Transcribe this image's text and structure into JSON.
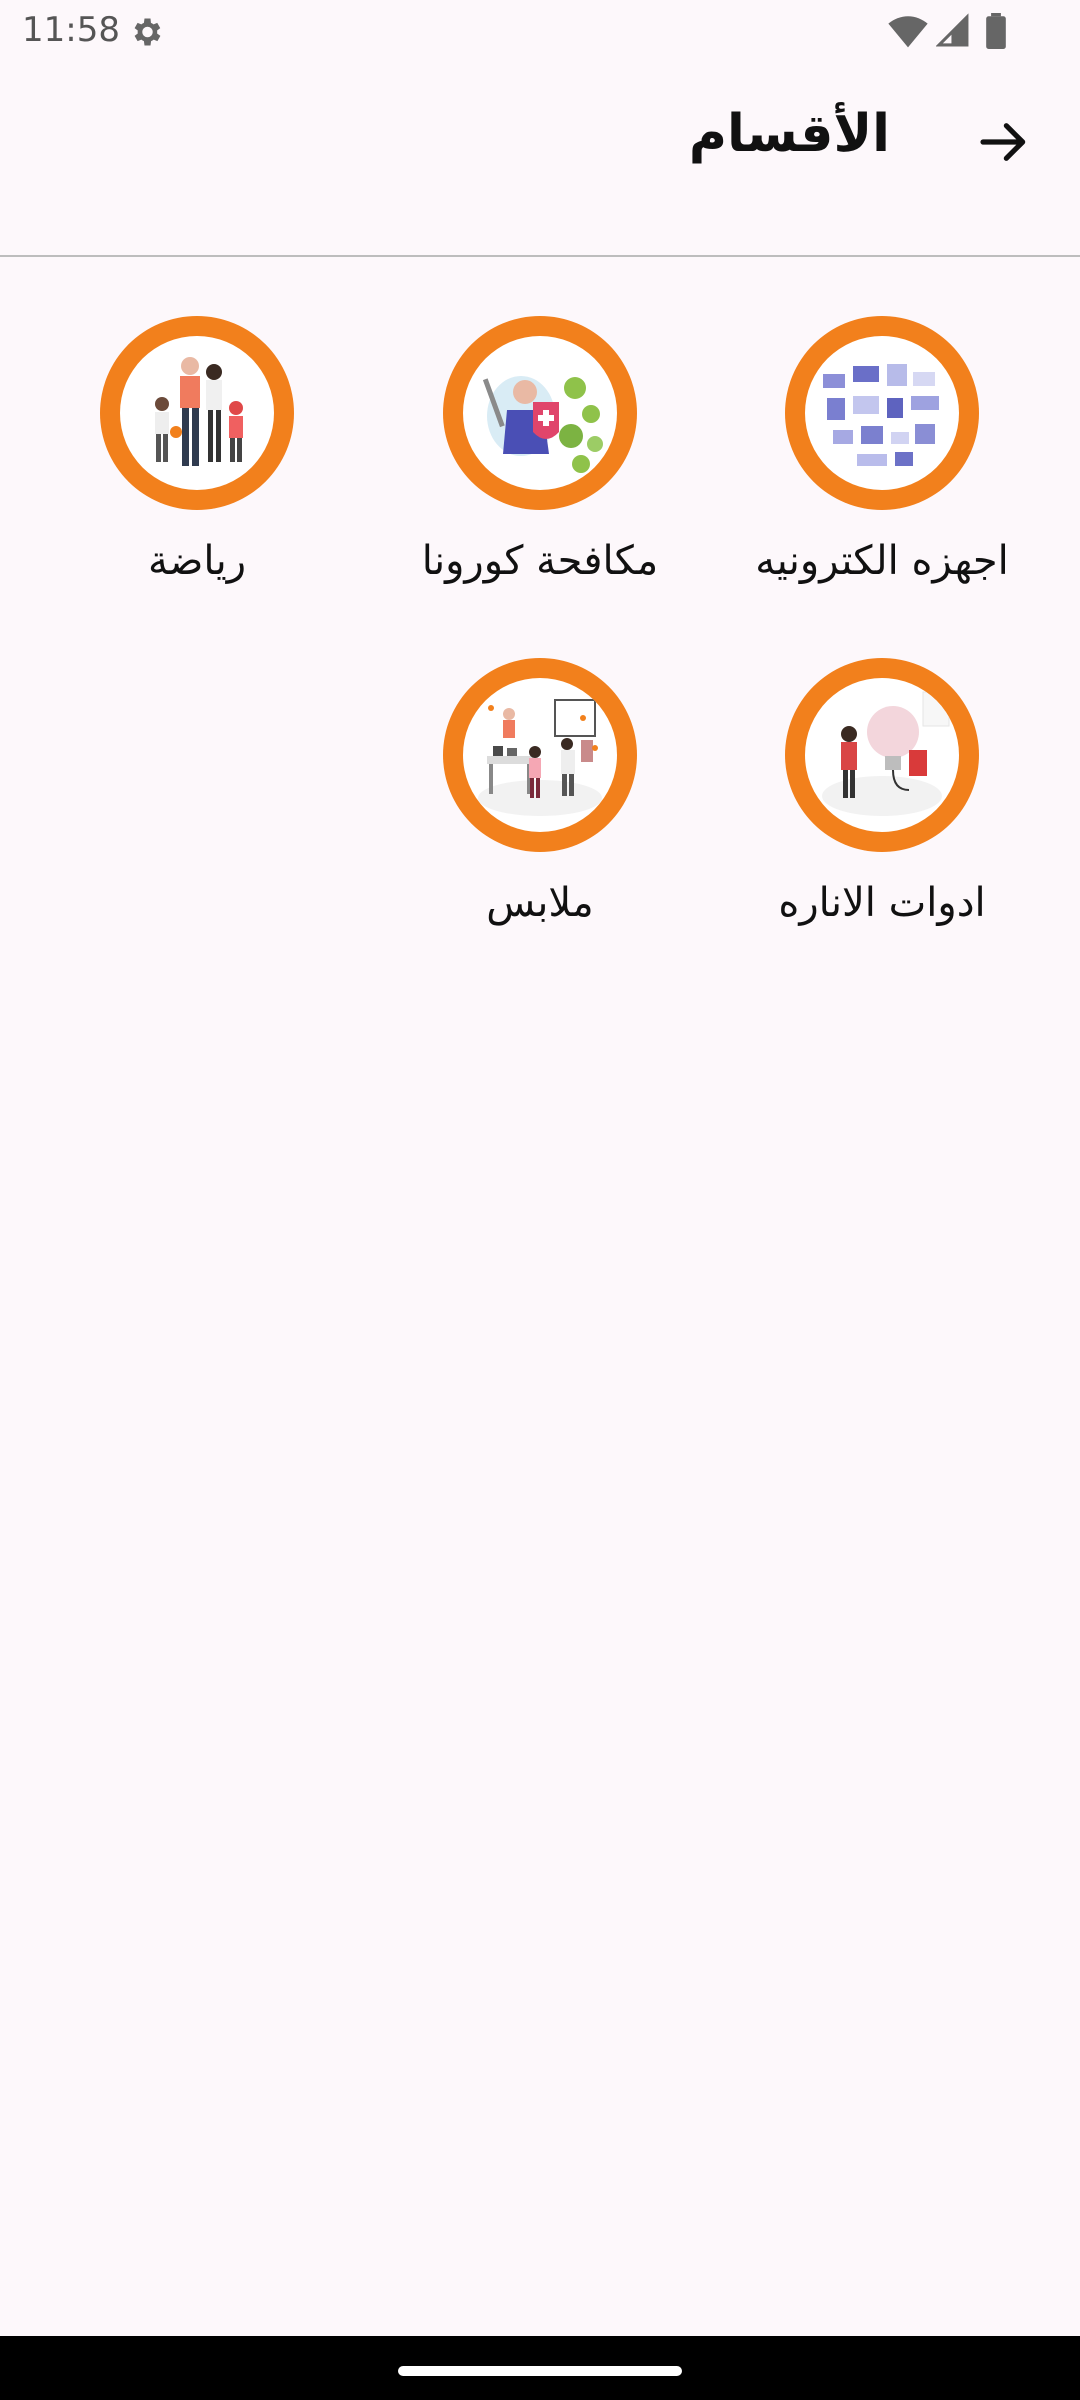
{
  "status": {
    "time": "11:58",
    "icons": [
      "gear-icon",
      "wifi-icon",
      "signal-icon",
      "battery-icon"
    ]
  },
  "header": {
    "title": "الأقسام",
    "back_icon": "arrow-right-icon"
  },
  "theme": {
    "accent": "#f2801c",
    "background": "#fdf8fb"
  },
  "categories": [
    {
      "label": "اجهزه الكترونيه",
      "icon": "electronics-illustration"
    },
    {
      "label": "مكافحة كورونا",
      "icon": "corona-fight-illustration"
    },
    {
      "label": "رياضة",
      "icon": "sports-family-illustration"
    },
    {
      "label": "ادوات الاناره",
      "icon": "lighting-bulb-illustration"
    },
    {
      "label": "ملابس",
      "icon": "clothes-shop-illustration"
    }
  ]
}
